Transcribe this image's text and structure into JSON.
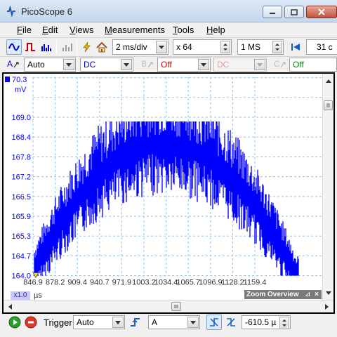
{
  "window": {
    "title": "PicoScope 6"
  },
  "menu": [
    {
      "label": "File",
      "u": "F",
      "rest": "ile"
    },
    {
      "label": "Edit",
      "u": "E",
      "rest": "dit"
    },
    {
      "label": "Views",
      "u": "V",
      "rest": "iews"
    },
    {
      "label": "Measurements",
      "u": "M",
      "rest": "easurements"
    },
    {
      "label": "Tools",
      "u": "T",
      "rest": "ools"
    },
    {
      "label": "Help",
      "u": "H",
      "rest": "elp"
    }
  ],
  "toolbar": {
    "timebase": "2 ms/div",
    "zoom": "x 64",
    "samples": "1 MS",
    "capture_count": "31 c"
  },
  "channels": {
    "a": {
      "label": "A",
      "range": "Auto",
      "coupling": "DC"
    },
    "b": {
      "label": "B",
      "range": "Off",
      "coupling": "DC"
    },
    "c": {
      "label": "C",
      "range": "Off"
    }
  },
  "scope": {
    "y_unit": "mV",
    "y_top_label": "70.3",
    "y_ticks": [
      "169.0",
      "168.4",
      "167.8",
      "167.2",
      "166.5",
      "165.9",
      "165.3",
      "164.7",
      "164.0"
    ],
    "x_ticks": [
      "846.9",
      "878.2",
      "909.4",
      "940.7",
      "971.9",
      "1003.2",
      "1034.4",
      "1065.7",
      "1096.9",
      "1128.2",
      "1159.4"
    ],
    "x_zoom_tag": "x1.0",
    "x_unit": "µs",
    "zoom_overview_label": "Zoom Overview",
    "trace_color": "#0000ff",
    "grid_color": "#8fc3e8"
  },
  "bottom": {
    "trigger_label": "Trigger",
    "trigger_mode": "Auto",
    "trigger_source": "A",
    "pre_trigger": "-610.5 µ"
  }
}
